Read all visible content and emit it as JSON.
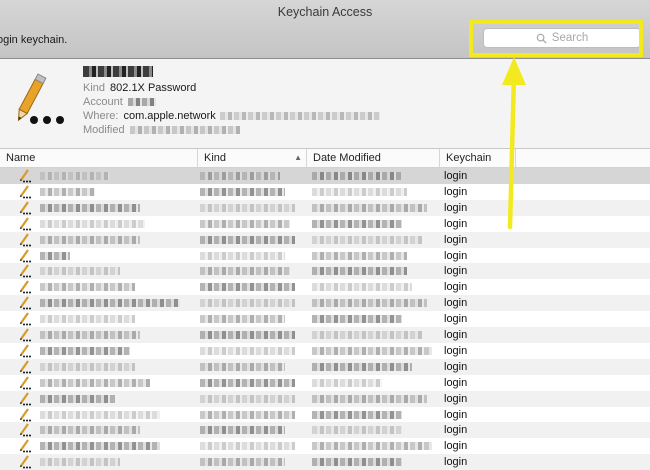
{
  "window": {
    "title": "Keychain Access",
    "subtitle": "ogin keychain."
  },
  "search": {
    "placeholder": "Search"
  },
  "detail": {
    "kind_label": "Kind",
    "kind_value": "802.1X Password",
    "account_label": "Account",
    "where_label": "Where:",
    "where_value": "com.apple.network",
    "modified_label": "Modified"
  },
  "columns": {
    "name": "Name",
    "kind": "Kind",
    "date": "Date Modified",
    "keychain": "Keychain"
  },
  "rows": [
    {
      "keychain": "login"
    },
    {
      "keychain": "login"
    },
    {
      "keychain": "login"
    },
    {
      "keychain": "login"
    },
    {
      "keychain": "login"
    },
    {
      "keychain": "login"
    },
    {
      "keychain": "login"
    },
    {
      "keychain": "login"
    },
    {
      "keychain": "login"
    },
    {
      "keychain": "login"
    },
    {
      "keychain": "login"
    },
    {
      "keychain": "login"
    },
    {
      "keychain": "login"
    },
    {
      "keychain": "login"
    },
    {
      "keychain": "login"
    },
    {
      "keychain": "login"
    },
    {
      "keychain": "login"
    },
    {
      "keychain": "login"
    },
    {
      "keychain": "login"
    }
  ],
  "colors": {
    "highlight": "#f2ea1e",
    "selected_row": "#d6d6d6"
  },
  "icons": [
    "search-icon",
    "pencil-ellipsis-icon",
    "sort-ascending-icon",
    "arrow-annotation"
  ]
}
